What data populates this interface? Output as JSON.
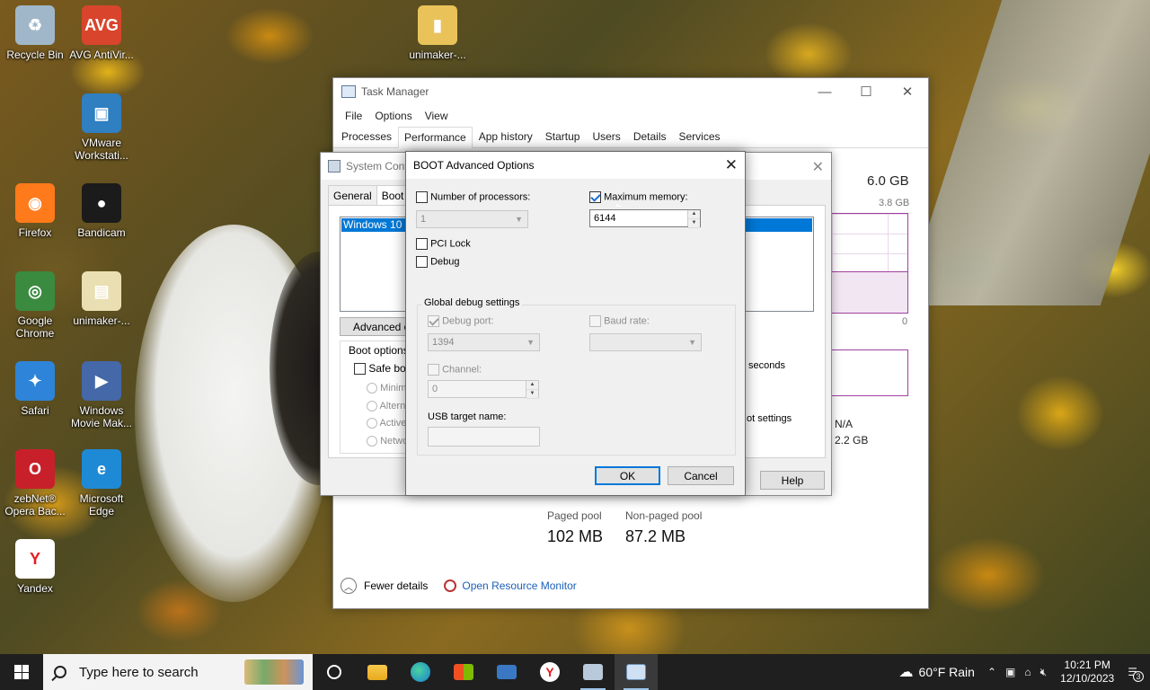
{
  "desktop": {
    "icons": [
      {
        "label": "Recycle Bin",
        "color": "#9fb7c9",
        "glyph": "♻"
      },
      {
        "label": "AVG AntiVir...",
        "color": "#d8452c",
        "glyph": "AVG"
      },
      {
        "label": "unimaker-...",
        "color": "#e9c35a",
        "glyph": "▮"
      },
      {
        "label": "VMware Workstati...",
        "color": "#2f7fc1",
        "glyph": "▣"
      },
      {
        "label": "Firefox",
        "color": "#ff7a1a",
        "glyph": "◉"
      },
      {
        "label": "Bandicam",
        "color": "#1b1b1b",
        "glyph": "●"
      },
      {
        "label": "Google Chrome",
        "color": "#3a8a3f",
        "glyph": "◎"
      },
      {
        "label": "unimaker-...",
        "color": "#e9dfb2",
        "glyph": "▤"
      },
      {
        "label": "Safari",
        "color": "#2e84d8",
        "glyph": "✦"
      },
      {
        "label": "Windows Movie Mak...",
        "color": "#4468a8",
        "glyph": "▶"
      },
      {
        "label": "zebNet® Opera Bac...",
        "color": "#c8202a",
        "glyph": "O"
      },
      {
        "label": "Microsoft Edge",
        "color": "#1e8ad6",
        "glyph": "e"
      },
      {
        "label": "Yandex",
        "color": "#ffffff",
        "glyph": "Y"
      }
    ]
  },
  "task_manager": {
    "title": "Task Manager",
    "menu": [
      "File",
      "Options",
      "View"
    ],
    "tabs": [
      "Processes",
      "Performance",
      "App history",
      "Startup",
      "Users",
      "Details",
      "Services"
    ],
    "active_tab": "Performance",
    "memory_total": "6.0 GB",
    "graph_max": "3.8 GB",
    "graph_min": "0",
    "seconds_label": "seconds",
    "na_value": "N/A",
    "cached_value": "2.2 GB",
    "paged_pool_label": "Paged pool",
    "paged_pool_value": "102 MB",
    "nonpaged_pool_label": "Non-paged pool",
    "nonpaged_pool_value": "87.2 MB",
    "fewer_details": "Fewer details",
    "open_resource_monitor": "Open Resource Monitor"
  },
  "system_config": {
    "title": "System Conf",
    "tabs": [
      "General",
      "Boot"
    ],
    "active_tab": "Boot",
    "os_entry": "Windows 10 (C",
    "advanced_button": "Advanced op",
    "boot_options_label": "Boot options",
    "safe_boot_label": "Safe boo",
    "safe_boot_checked": false,
    "safe_modes": [
      "Minima",
      "Altern",
      "Active",
      "Netwo"
    ],
    "timeout_suffix": "seconds",
    "make_permanent_text": "ot settings",
    "help_button": "Help"
  },
  "boot_dialog": {
    "title": "BOOT Advanced Options",
    "num_processors_label": "Number of processors:",
    "num_processors_checked": false,
    "num_processors_value": "1",
    "max_memory_label": "Maximum memory:",
    "max_memory_checked": true,
    "max_memory_value": "6144",
    "pci_lock_label": "PCI Lock",
    "pci_lock_checked": false,
    "debug_label": "Debug",
    "debug_checked": false,
    "global_debug_label": "Global debug settings",
    "debug_port_label": "Debug port:",
    "debug_port_checked": true,
    "debug_port_value": "1394",
    "baud_rate_label": "Baud rate:",
    "baud_rate_checked": false,
    "baud_rate_value": "",
    "channel_label": "Channel:",
    "channel_checked": false,
    "channel_value": "0",
    "usb_target_label": "USB target name:",
    "usb_target_value": "",
    "ok_button": "OK",
    "cancel_button": "Cancel"
  },
  "taskbar": {
    "search_placeholder": "Type here to search",
    "apps": [
      "task-view",
      "file-explorer",
      "edge",
      "microsoft-store",
      "remote-desktop",
      "yandex",
      "system-configuration",
      "task-manager"
    ],
    "weather": "60°F  Rain",
    "time": "10:21 PM",
    "date": "12/10/2023",
    "notification_count": "3"
  }
}
